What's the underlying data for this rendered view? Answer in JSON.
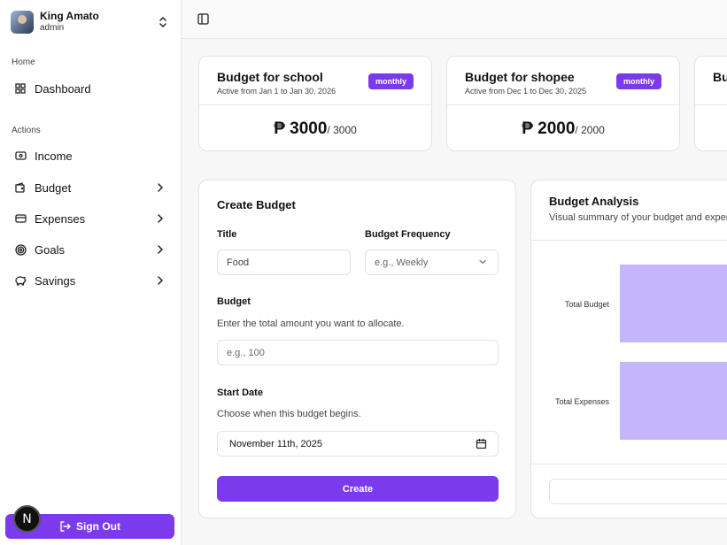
{
  "user": {
    "name": "King Amato",
    "role": "admin"
  },
  "sidebar": {
    "home_label": "Home",
    "actions_label": "Actions",
    "items": [
      {
        "label": "Dashboard",
        "icon": "dashboard-icon"
      },
      {
        "label": "Income",
        "icon": "cash-icon"
      },
      {
        "label": "Budget",
        "icon": "wallet-icon"
      },
      {
        "label": "Expenses",
        "icon": "credit-card-icon"
      },
      {
        "label": "Goals",
        "icon": "target-icon"
      },
      {
        "label": "Savings",
        "icon": "piggy-bank-icon"
      }
    ],
    "signout_label": "Sign Out"
  },
  "dev_badge": "N",
  "budgets": [
    {
      "title": "Budget for school",
      "period": "Active from Jan 1 to Jan 30, 2026",
      "frequency": "monthly",
      "spent": "₱ 3000",
      "total": "/ 3000"
    },
    {
      "title": "Budget for shopee",
      "period": "Active from Dec 1 to Dec 30, 2025",
      "frequency": "monthly",
      "spent": "₱ 2000",
      "total": "/ 2000"
    },
    {
      "title": "Bu"
    }
  ],
  "form": {
    "title": "Create Budget",
    "title_label": "Title",
    "title_value": "Food",
    "frequency_label": "Budget Frequency",
    "frequency_placeholder": "e.g., Weekly",
    "budget_label": "Budget",
    "budget_hint": "Enter the total amount you want to allocate.",
    "budget_placeholder": "e.g., 100",
    "start_label": "Start Date",
    "start_hint": "Choose when this budget begins.",
    "start_value": "November 11th, 2025",
    "submit_label": "Create"
  },
  "analysis": {
    "title": "Budget Analysis",
    "subtitle": "Visual summary of your budget and expenses",
    "bars": [
      {
        "label": "Total Budget"
      },
      {
        "label": "Total Expenses"
      }
    ],
    "bar_color": "#c4b5fd"
  },
  "colors": {
    "accent": "#7c3aed"
  }
}
